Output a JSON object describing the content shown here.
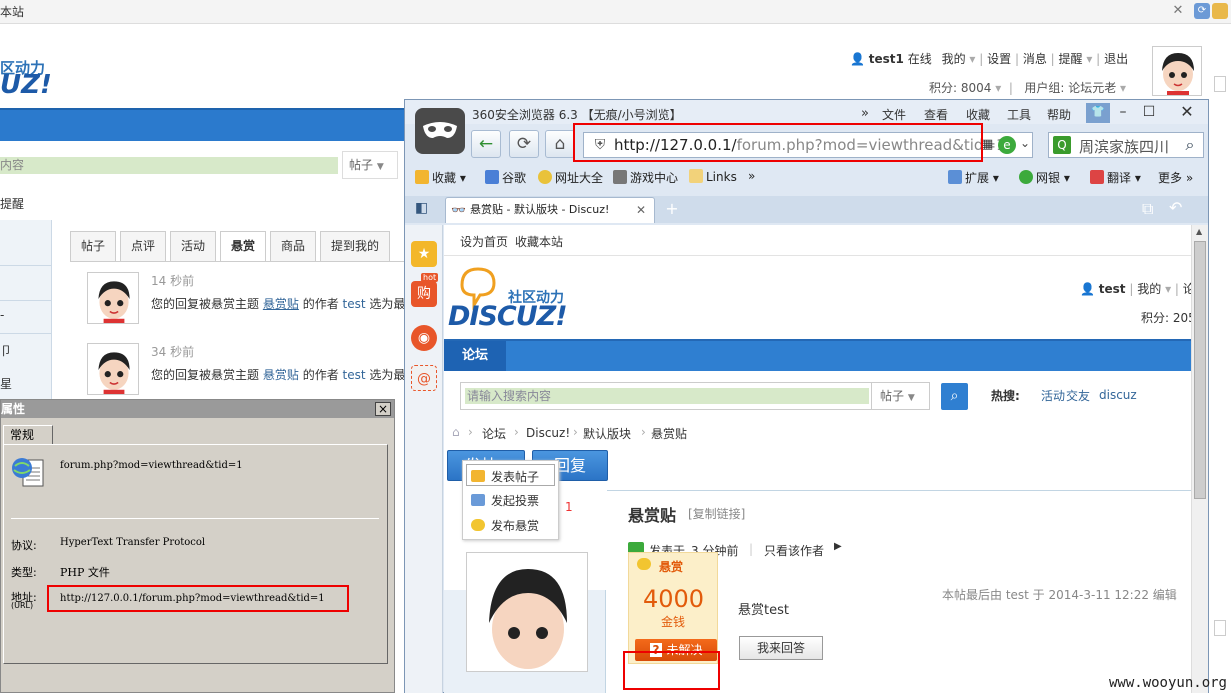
{
  "bg_page": {
    "top_text": "本站",
    "logo_line1": "区动力",
    "logo_line2": "UZ!",
    "user": {
      "name": "test1",
      "status": "在线",
      "links": [
        "我的",
        "设置",
        "消息",
        "提醒",
        "退出"
      ],
      "points": "积分: 8004",
      "group": "用户组: 论坛元老"
    },
    "search_placeholder": "内容",
    "search_select": "帖子",
    "remind_label": "提醒",
    "tabs": [
      "帖子",
      "点评",
      "活动",
      "悬赏",
      "商品",
      "提到我的"
    ],
    "active_tab": "悬赏",
    "notifications": [
      {
        "time": "14 秒前",
        "prefix": "您的回复被悬赏主题",
        "thread": "悬赏贴",
        "middle": "的作者",
        "user": "test",
        "suffix": "选为最"
      },
      {
        "time": "34 秒前",
        "prefix": "您的回复被悬赏主题",
        "thread": "悬赏贴",
        "middle": "的作者",
        "user": "test",
        "suffix": "选为最"
      }
    ],
    "left_col_marks": [
      "-",
      "卩",
      "星"
    ]
  },
  "properties_dialog": {
    "title": "属性",
    "tab": "常规",
    "filename": "forum.php?mod=viewthread&tid=1",
    "protocol_label": "协议:",
    "protocol_value": "HyperText Transfer Protocol",
    "type_label": "类型:",
    "type_value": "PHP 文件",
    "address_label": "地址:",
    "address_label_sub": "(URL)",
    "address_value": "http://127.0.0.1/forum.php?mod=viewthread&tid=1",
    "close": "×"
  },
  "browser": {
    "title": "360安全浏览器 6.3 【无痕/小号浏览】",
    "menus": [
      "文件",
      "查看",
      "收藏",
      "工具",
      "帮助"
    ],
    "chevron": "»",
    "address_url_host": "http://127.0.0.1/",
    "address_url_rest": "forum.php?mod=viewthread&tid=1",
    "search_text": "周滨家族四川",
    "favorites": [
      "收藏",
      "谷歌",
      "网址大全",
      "游戏中心",
      "Links"
    ],
    "favbar_right": [
      "扩展",
      "网银",
      "翻译",
      "更多"
    ],
    "tab_title": "悬赏贴 - 默认版块 - Discuz!",
    "sidebar_badge": "hot",
    "sidebar_badge_label": "购",
    "colors": {
      "accent": "#2f7fd1",
      "highlight": "#e00000",
      "reward": "#e25b0b"
    }
  },
  "forum": {
    "top_links": [
      "设为首页",
      "收藏本站"
    ],
    "logo_cn": "社区动力",
    "logo_en": "DISCUZ!",
    "user_name": "test",
    "user_my": "我的",
    "user_more": "论",
    "points": "积分: 205",
    "nav_tab": "论坛",
    "search_placeholder": "请输入搜索内容",
    "search_select": "帖子",
    "hot_label": "热搜:",
    "hot_items": [
      "活动",
      "交友",
      "discuz"
    ],
    "breadcrumb": [
      "论坛",
      "Discuz!",
      "默认版块",
      "悬赏贴"
    ],
    "post_button": "发帖",
    "reply_button": "回复",
    "dropdown": [
      "发表帖子",
      "发起投票",
      "发布悬赏"
    ],
    "count": "1",
    "thread_title": "悬赏贴",
    "copy_link": "[复制链接]",
    "posted_prefix": "发表于",
    "posted_time": "3 分钟前",
    "only_author": "只看该作者",
    "edit_note": "本帖最后由 test 于 2014-3-11 12:22 编辑",
    "reward_label": "悬赏",
    "reward_amount": "4000",
    "reward_unit": "金钱",
    "unsolved": "未解决",
    "post_body": "悬赏test",
    "answer_button": "我来回答"
  },
  "watermark": "www.wooyun.org"
}
